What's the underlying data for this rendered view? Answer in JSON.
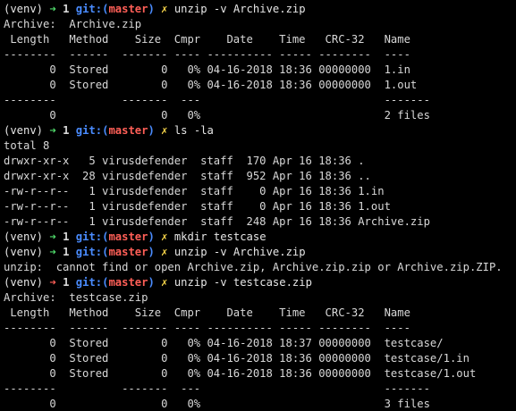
{
  "colors": {
    "background": "#000000",
    "text": "#d8d8d8",
    "arrow_success": "#4fd86a",
    "arrow_error": "#ff5f57",
    "git_label": "#4a8cff",
    "branch_name": "#ff5f57",
    "dirty_marker": "#f7d54a"
  },
  "prompt": {
    "venv": "(venv)",
    "arrow": "➜",
    "count": "1",
    "git_prefix": "git:(",
    "branch": "master",
    "git_suffix": ")",
    "dirty": "✗"
  },
  "lines": [
    {
      "type": "prompt",
      "status": "ok",
      "command": "unzip -v Archive.zip"
    },
    {
      "type": "text",
      "text": "Archive:  Archive.zip"
    },
    {
      "type": "text",
      "text": " Length   Method    Size  Cmpr    Date    Time   CRC-32   Name"
    },
    {
      "type": "text",
      "text": "--------  ------  ------- ---- ---------- ----- --------  ----"
    },
    {
      "type": "text",
      "text": "       0  Stored        0   0% 04-16-2018 18:36 00000000  1.in"
    },
    {
      "type": "text",
      "text": "       0  Stored        0   0% 04-16-2018 18:36 00000000  1.out"
    },
    {
      "type": "text",
      "text": "--------          -------  ---                            -------"
    },
    {
      "type": "text",
      "text": "       0                0   0%                            2 files"
    },
    {
      "type": "prompt",
      "status": "ok",
      "command": "ls -la"
    },
    {
      "type": "text",
      "text": "total 8"
    },
    {
      "type": "text",
      "text": "drwxr-xr-x   5 virusdefender  staff  170 Apr 16 18:36 ."
    },
    {
      "type": "text",
      "text": "drwxr-xr-x  28 virusdefender  staff  952 Apr 16 18:36 .."
    },
    {
      "type": "text",
      "text": "-rw-r--r--   1 virusdefender  staff    0 Apr 16 18:36 1.in"
    },
    {
      "type": "text",
      "text": "-rw-r--r--   1 virusdefender  staff    0 Apr 16 18:36 1.out"
    },
    {
      "type": "text",
      "text": "-rw-r--r--   1 virusdefender  staff  248 Apr 16 18:36 Archive.zip"
    },
    {
      "type": "prompt",
      "status": "ok",
      "command": "mkdir testcase"
    },
    {
      "type": "prompt",
      "status": "ok",
      "command": "unzip -v Archive.zip"
    },
    {
      "type": "text",
      "text": "unzip:  cannot find or open Archive.zip, Archive.zip.zip or Archive.zip.ZIP."
    },
    {
      "type": "prompt",
      "status": "error",
      "command": "unzip -v testcase.zip"
    },
    {
      "type": "text",
      "text": "Archive:  testcase.zip"
    },
    {
      "type": "text",
      "text": " Length   Method    Size  Cmpr    Date    Time   CRC-32   Name"
    },
    {
      "type": "text",
      "text": "--------  ------  ------- ---- ---------- ----- --------  ----"
    },
    {
      "type": "text",
      "text": "       0  Stored        0   0% 04-16-2018 18:37 00000000  testcase/"
    },
    {
      "type": "text",
      "text": "       0  Stored        0   0% 04-16-2018 18:36 00000000  testcase/1.in"
    },
    {
      "type": "text",
      "text": "       0  Stored        0   0% 04-16-2018 18:36 00000000  testcase/1.out"
    },
    {
      "type": "text",
      "text": "--------          -------  ---                            -------"
    },
    {
      "type": "text",
      "text": "       0                0   0%                            3 files"
    }
  ]
}
